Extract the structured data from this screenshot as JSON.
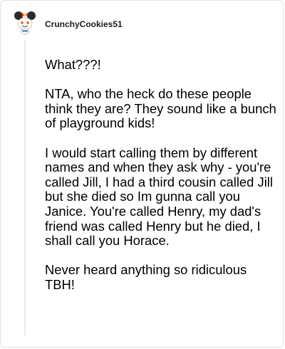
{
  "comment": {
    "username": "CrunchyCookies51",
    "paragraphs": [
      "What???!",
      "NTA, who the heck do these people think they are? They sound like a bunch of playground kids!",
      "I would start calling them by different names and when they ask why - you're called Jill, I had a third cousin called Jill but she died so Im gunna call you Janice. You're called Henry, my dad's friend was called Henry but he died, I shall call you Horace.",
      "Never heard anything so ridiculous TBH!"
    ]
  },
  "icons": {
    "avatar": "reddit-snoo-avatar-icon"
  },
  "colors": {
    "thread_line": "#e9e9e9",
    "avatar_mouse_ears": "#2b2b2b",
    "avatar_accent": "#ff4500"
  }
}
